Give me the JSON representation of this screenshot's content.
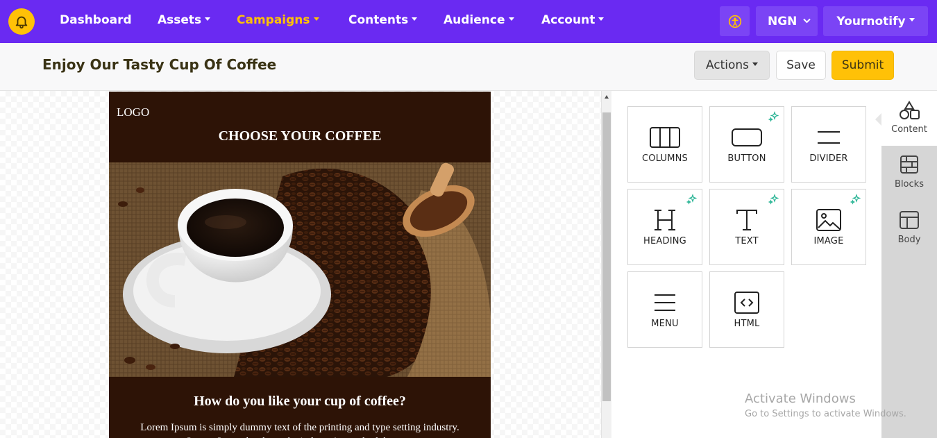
{
  "nav": {
    "items": [
      {
        "label": "Dashboard",
        "dropdown": false,
        "active": false
      },
      {
        "label": "Assets",
        "dropdown": true,
        "active": false
      },
      {
        "label": "Campaigns",
        "dropdown": true,
        "active": true
      },
      {
        "label": "Contents",
        "dropdown": true,
        "active": false
      },
      {
        "label": "Audience",
        "dropdown": true,
        "active": false
      },
      {
        "label": "Account",
        "dropdown": true,
        "active": false
      }
    ],
    "currency": "NGN",
    "brand": "Yournotify",
    "icons": [
      "bell-icon",
      "accessibility-icon",
      "chevron-down-icon"
    ],
    "colors": {
      "bar": "#6a2af2",
      "active": "#ffc107"
    }
  },
  "header": {
    "title": "Enjoy Our Tasty Cup Of Coffee",
    "actions_label": "Actions",
    "save_label": "Save",
    "submit_label": "Submit"
  },
  "email": {
    "logo": "LOGO",
    "heading": "CHOOSE YOUR COFFEE",
    "subheading": "How do you like your cup of coffee?",
    "body": "Lorem Ipsum is simply dummy text of the printing and type setting industry. Lorem Ipsum has been the industry's standard dummy",
    "colors": {
      "background": "#2d1306"
    }
  },
  "tools": [
    {
      "label": "COLUMNS",
      "icon": "columns-icon",
      "new": false
    },
    {
      "label": "BUTTON",
      "icon": "button-icon",
      "new": true
    },
    {
      "label": "DIVIDER",
      "icon": "divider-icon",
      "new": false
    },
    {
      "label": "HEADING",
      "icon": "heading-icon",
      "new": true
    },
    {
      "label": "TEXT",
      "icon": "text-icon",
      "new": true
    },
    {
      "label": "IMAGE",
      "icon": "image-icon",
      "new": true
    },
    {
      "label": "MENU",
      "icon": "menu-icon",
      "new": false
    },
    {
      "label": "HTML",
      "icon": "html-icon",
      "new": false
    }
  ],
  "sidetabs": [
    {
      "label": "Content",
      "icon": "shapes-icon",
      "active": true
    },
    {
      "label": "Blocks",
      "icon": "blocks-icon",
      "active": false
    },
    {
      "label": "Body",
      "icon": "layout-icon",
      "active": false
    }
  ],
  "watermark": {
    "title": "Activate Windows",
    "subtitle": "Go to Settings to activate Windows."
  }
}
